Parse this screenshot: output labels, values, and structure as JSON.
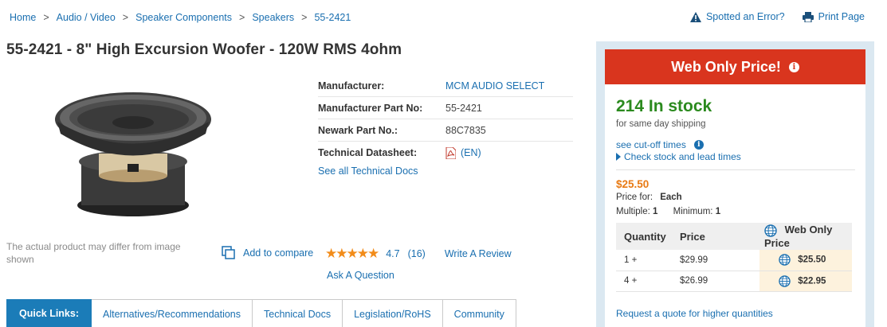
{
  "breadcrumb": {
    "items": [
      "Home",
      "Audio / Video",
      "Speaker Components",
      "Speakers",
      "55-2421"
    ],
    "separator": ">"
  },
  "top_actions": {
    "spotted_error": "Spotted an Error?",
    "print_page": "Print Page"
  },
  "product": {
    "title": "55-2421 -  8\" High Excursion Woofer - 120W RMS 4ohm",
    "image_disclaimer": "The actual product may differ from image shown"
  },
  "specs": {
    "manufacturer_label": "Manufacturer:",
    "manufacturer_value": "MCM AUDIO SELECT",
    "mfr_part_label": "Manufacturer Part No:",
    "mfr_part_value": "55-2421",
    "newark_label": "Newark Part No.:",
    "newark_value": "88C7835",
    "datasheet_label": "Technical Datasheet:",
    "datasheet_value": "(EN)",
    "see_all": "See all Technical Docs"
  },
  "actions": {
    "compare": "Add to compare",
    "stars": "★★★★★",
    "rating": "4.7",
    "review_count": "(16)",
    "write_review": "Write A Review",
    "ask_question": "Ask A Question"
  },
  "quick_links": {
    "label": "Quick Links:",
    "tabs": [
      "Alternatives/Recommendations",
      "Technical Docs",
      "Legislation/RoHS",
      "Community"
    ]
  },
  "buy_box": {
    "banner": "Web Only Price!",
    "info_glyph": "i",
    "stock": "214 In stock",
    "shipping": "for same day shipping",
    "cutoff": "see cut-off times",
    "check_lead": "Check stock and lead times",
    "price": "$25.50",
    "price_for_label": "Price for:",
    "price_for_value": "Each",
    "multiple_label": "Multiple:",
    "multiple_value": "1",
    "minimum_label": "Minimum:",
    "minimum_value": "1",
    "table": {
      "headers": [
        "Quantity",
        "Price",
        "Web Only Price"
      ],
      "rows": [
        {
          "qty": "1 +",
          "price": "$29.99",
          "web": "$25.50"
        },
        {
          "qty": "4 +",
          "price": "$26.99",
          "web": "$22.95"
        }
      ]
    },
    "quote": "Request a quote for higher quantities"
  },
  "colors": {
    "link": "#1a6fb0",
    "banner_red": "#d9351e",
    "stock_green": "#2b8a1e",
    "price_orange": "#e87a14",
    "quicklinks_blue": "#1b7cb8",
    "star_orange": "#f28c1a"
  }
}
